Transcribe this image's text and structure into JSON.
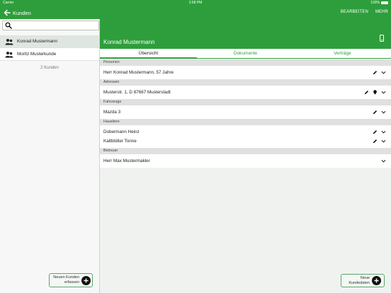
{
  "status_bar": {
    "carrier": "Carrier",
    "time": "2:58 PM",
    "battery": "100%"
  },
  "left_header": {
    "title": "Kunden"
  },
  "right_header": {
    "actions": {
      "edit": "BEARBEITEN",
      "more": "MEHR"
    },
    "customer_name": "Konrad Mustermann"
  },
  "search": {
    "value": "",
    "placeholder": ""
  },
  "customers": [
    {
      "name": "Konrad Mustermann",
      "selected": true
    },
    {
      "name": "Moritz Musterkunde",
      "selected": false
    }
  ],
  "customer_count": "2 Kunden",
  "new_customer_button": "Neuen Kunden\nerfassen",
  "tabs": [
    {
      "label": "Übersicht",
      "active": true
    },
    {
      "label": "Dokumente",
      "active": false
    },
    {
      "label": "Verträge",
      "active": false
    }
  ],
  "sections": {
    "personen": {
      "header": "Personen",
      "rows": [
        "Herr Konrad Mustermann, 57 Jahre"
      ]
    },
    "adressen": {
      "header": "Adressen",
      "rows": [
        "Musterstr. 1, D 87667 Musterstadt"
      ]
    },
    "fahrzeuge": {
      "header": "Fahrzeuge",
      "rows": [
        "Mazda 3"
      ]
    },
    "haustiere": {
      "header": "Haustiere",
      "rows": [
        "Dobermann Heinz",
        "Kaltblütler Tonne"
      ]
    },
    "betreuer": {
      "header": "Betreuer",
      "rows": [
        "Herr Max Mustermakler"
      ]
    }
  },
  "new_data_button": "Neue\nKundedaten",
  "colors": {
    "accent": "#2e9e3c",
    "section_header": "#e0e0e0",
    "content_bg": "#f0f2f0"
  }
}
